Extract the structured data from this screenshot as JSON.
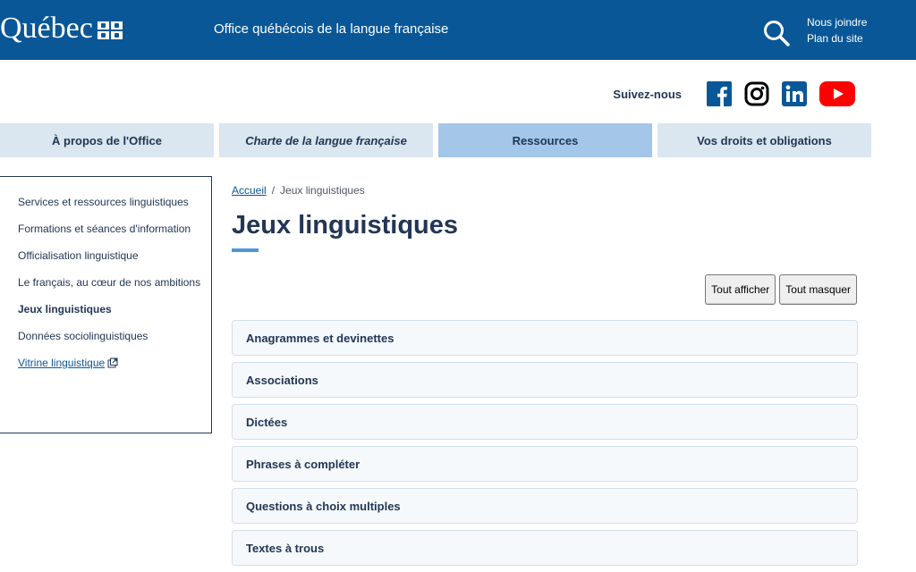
{
  "header": {
    "logo_text": "Québec",
    "agency": "Office québécois de la langue française",
    "quick_links": [
      "Nous joindre",
      "Plan du site"
    ]
  },
  "social": {
    "label": "Suivez-nous",
    "icons": [
      "facebook-icon",
      "instagram-icon",
      "linkedin-icon",
      "youtube-icon"
    ]
  },
  "nav": {
    "items": [
      "À propos de l'Office",
      "Charte de la langue française",
      "Ressources",
      "Vos droits et obligations"
    ],
    "active": "Ressources"
  },
  "sidebar": {
    "items": [
      "Services et ressources linguistiques",
      "Formations et séances d'information",
      "Officialisation linguistique",
      "Le français, au cœur de nos ambitions",
      "Jeux linguistiques",
      "Données sociolinguistiques",
      "Vitrine linguistique"
    ]
  },
  "breadcrumb": {
    "home": "Accueil",
    "separator": "/",
    "current": "Jeux linguistiques"
  },
  "page": {
    "title": "Jeux linguistiques",
    "show_all": "Tout afficher",
    "hide_all": "Tout masquer"
  },
  "accordion": [
    "Anagrammes et devinettes",
    "Associations",
    "Dictées",
    "Phrases à compléter",
    "Questions à choix multiples",
    "Textes à trous"
  ],
  "colors": {
    "brand": "#095797",
    "nav_bg": "#dae6f0",
    "nav_active": "#a3c6e9",
    "text": "#223654"
  }
}
